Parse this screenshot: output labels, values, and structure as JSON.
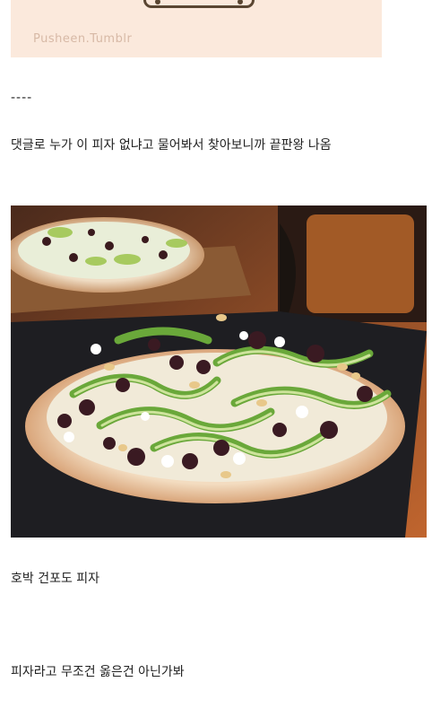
{
  "comic": {
    "watermark": "Pusheen.Tumblr"
  },
  "post": {
    "divider": "----",
    "line1": "댓글로 누가 이 피자 없냐고 물어봐서 찾아보니까 끝판왕 나옴",
    "line2": "호박 건포도 피자",
    "line3": "피자라고 무조건 옳은건 아닌가봐"
  },
  "photo": {
    "subject": "zucchini raisin pizza"
  }
}
